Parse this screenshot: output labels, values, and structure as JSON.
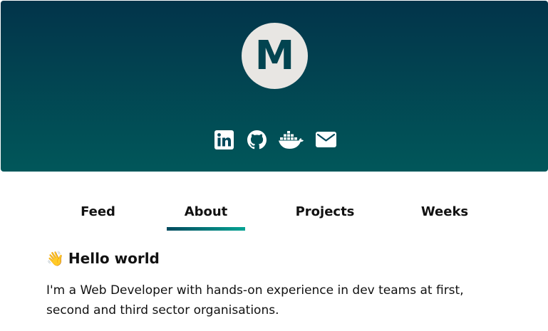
{
  "profile": {
    "initial": "M"
  },
  "socials": [
    {
      "name": "linkedin-icon"
    },
    {
      "name": "github-icon"
    },
    {
      "name": "docker-icon"
    },
    {
      "name": "mail-icon"
    }
  ],
  "tabs": [
    {
      "label": "Feed"
    },
    {
      "label": "About",
      "active": true
    },
    {
      "label": "Projects"
    },
    {
      "label": "Weeks"
    }
  ],
  "about": {
    "emoji": "👋",
    "heading": "Hello world",
    "body": "I'm a Web Developer with hands-on experience in dev teams at first, second and third sector organisations."
  },
  "colors": {
    "header_top": "#02344a",
    "header_bottom": "#01575a",
    "avatar_bg": "#e8e6e3",
    "avatar_text": "#024450",
    "underline_start": "#024a5e",
    "underline_end": "#04a393"
  }
}
